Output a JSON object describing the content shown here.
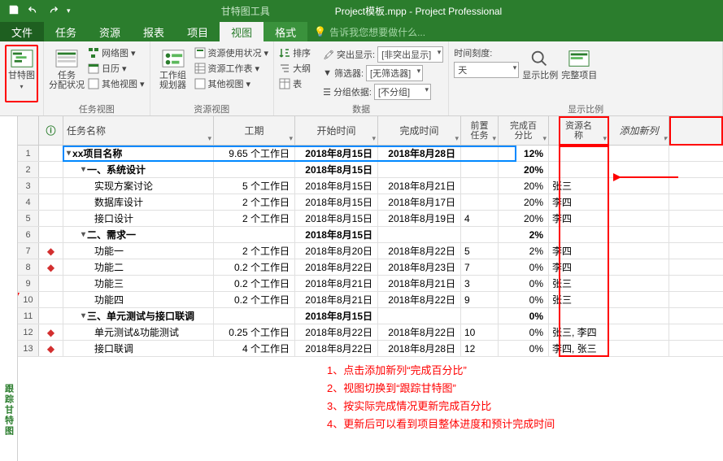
{
  "titlebar": {
    "context_title": "甘特图工具",
    "window_title": "Project模板.mpp - Project Professional"
  },
  "tabs": {
    "file": "文件",
    "task": "任务",
    "resource": "资源",
    "report": "报表",
    "project": "项目",
    "view": "视图",
    "format": "格式",
    "tell": "告诉我您想要做什么..."
  },
  "ribbon": {
    "g1": {
      "gantt": "甘特图",
      "label": ""
    },
    "g2": {
      "taskusage": "任务\n分配状况",
      "network": "网络图",
      "calendar": "日历",
      "other": "其他视图",
      "label": "任务视图"
    },
    "g3": {
      "team": "工作组\n规划器",
      "resuse": "资源使用状况",
      "ressheet": "资源工作表",
      "other": "其他视图",
      "label": "资源视图"
    },
    "g4": {
      "sort": "排序",
      "outline": "大纲",
      "table": "表",
      "highlight": "突出显示:",
      "hl_val": "[非突出显示]",
      "filter": "筛选器:",
      "filter_val": "[无筛选器]",
      "group": "分组依据:",
      "group_val": "[不分组]",
      "label": "数据"
    },
    "g5": {
      "scale": "时间刻度:",
      "scale_val": "天",
      "zoom": "显示比例",
      "entire": "完整项目",
      "label": "显示比例"
    }
  },
  "columns": {
    "name": "任务名称",
    "duration": "工期",
    "start": "开始时间",
    "finish": "完成时间",
    "pred": "前置\n任务",
    "pct": "完成百\n分比",
    "res": "资源名\n称",
    "new": "添加新列"
  },
  "rows": [
    {
      "n": 1,
      "i": "",
      "name": "xx项目名称",
      "cls": "bold collapse",
      "ind": 0,
      "dur": "9.65 个工作日",
      "start": "2018年8月15日",
      "fin": "2018年8月28日",
      "pred": "",
      "pct": "12%",
      "res": ""
    },
    {
      "n": 2,
      "i": "",
      "name": "一、系统设计",
      "cls": "bold collapse",
      "ind": 1,
      "dur": "",
      "start": "2018年8月15日",
      "fin": "",
      "pred": "",
      "pct": "20%",
      "res": ""
    },
    {
      "n": 3,
      "i": "",
      "name": "实现方案讨论",
      "cls": "",
      "ind": 2,
      "dur": "5 个工作日",
      "start": "2018年8月15日",
      "fin": "2018年8月21日",
      "pred": "",
      "pct": "20%",
      "res": "张三"
    },
    {
      "n": 4,
      "i": "",
      "name": "数据库设计",
      "cls": "",
      "ind": 2,
      "dur": "2 个工作日",
      "start": "2018年8月15日",
      "fin": "2018年8月17日",
      "pred": "",
      "pct": "20%",
      "res": "李四"
    },
    {
      "n": 5,
      "i": "",
      "name": "接口设计",
      "cls": "",
      "ind": 2,
      "dur": "2 个工作日",
      "start": "2018年8月15日",
      "fin": "2018年8月19日",
      "pred": "4",
      "pct": "20%",
      "res": "李四"
    },
    {
      "n": 6,
      "i": "",
      "name": "二、需求一",
      "cls": "bold collapse",
      "ind": 1,
      "dur": "",
      "start": "2018年8月15日",
      "fin": "",
      "pred": "",
      "pct": "2%",
      "res": ""
    },
    {
      "n": 7,
      "i": "p",
      "name": "功能一",
      "cls": "",
      "ind": 2,
      "dur": "2 个工作日",
      "start": "2018年8月20日",
      "fin": "2018年8月22日",
      "pred": "5",
      "pct": "2%",
      "res": "李四"
    },
    {
      "n": 8,
      "i": "p",
      "name": "功能二",
      "cls": "",
      "ind": 2,
      "dur": "0.2 个工作日",
      "start": "2018年8月22日",
      "fin": "2018年8月23日",
      "pred": "7",
      "pct": "0%",
      "res": "李四"
    },
    {
      "n": 9,
      "i": "",
      "name": "功能三",
      "cls": "",
      "ind": 2,
      "dur": "0.2 个工作日",
      "start": "2018年8月21日",
      "fin": "2018年8月21日",
      "pred": "3",
      "pct": "0%",
      "res": "张三"
    },
    {
      "n": 10,
      "i": "",
      "name": "功能四",
      "cls": "",
      "ind": 2,
      "dur": "0.2 个工作日",
      "start": "2018年8月21日",
      "fin": "2018年8月22日",
      "pred": "9",
      "pct": "0%",
      "res": "张三"
    },
    {
      "n": 11,
      "i": "",
      "name": "三、单元测试与接口联调",
      "cls": "bold collapse",
      "ind": 1,
      "dur": "",
      "start": "2018年8月15日",
      "fin": "",
      "pred": "",
      "pct": "0%",
      "res": ""
    },
    {
      "n": 12,
      "i": "p",
      "name": "单元测试&功能测试",
      "cls": "",
      "ind": 2,
      "dur": "0.25 个工作日",
      "start": "2018年8月22日",
      "fin": "2018年8月22日",
      "pred": "10",
      "pct": "0%",
      "res": "张三, 李四"
    },
    {
      "n": 13,
      "i": "p",
      "name": "接口联调",
      "cls": "",
      "ind": 2,
      "dur": "4 个工作日",
      "start": "2018年8月22日",
      "fin": "2018年8月28日",
      "pred": "12",
      "pct": "0%",
      "res": "李四, 张三"
    }
  ],
  "notes": {
    "l1": "1、点击添加新列“完成百分比”",
    "l2": "2、视图切换到“跟踪甘特图”",
    "l3": "3、按实际完成情况更新完成百分比",
    "l4": "4、更新后可以看到项目整体进度和预计完成时间"
  },
  "side_label": "跟踪甘特图"
}
